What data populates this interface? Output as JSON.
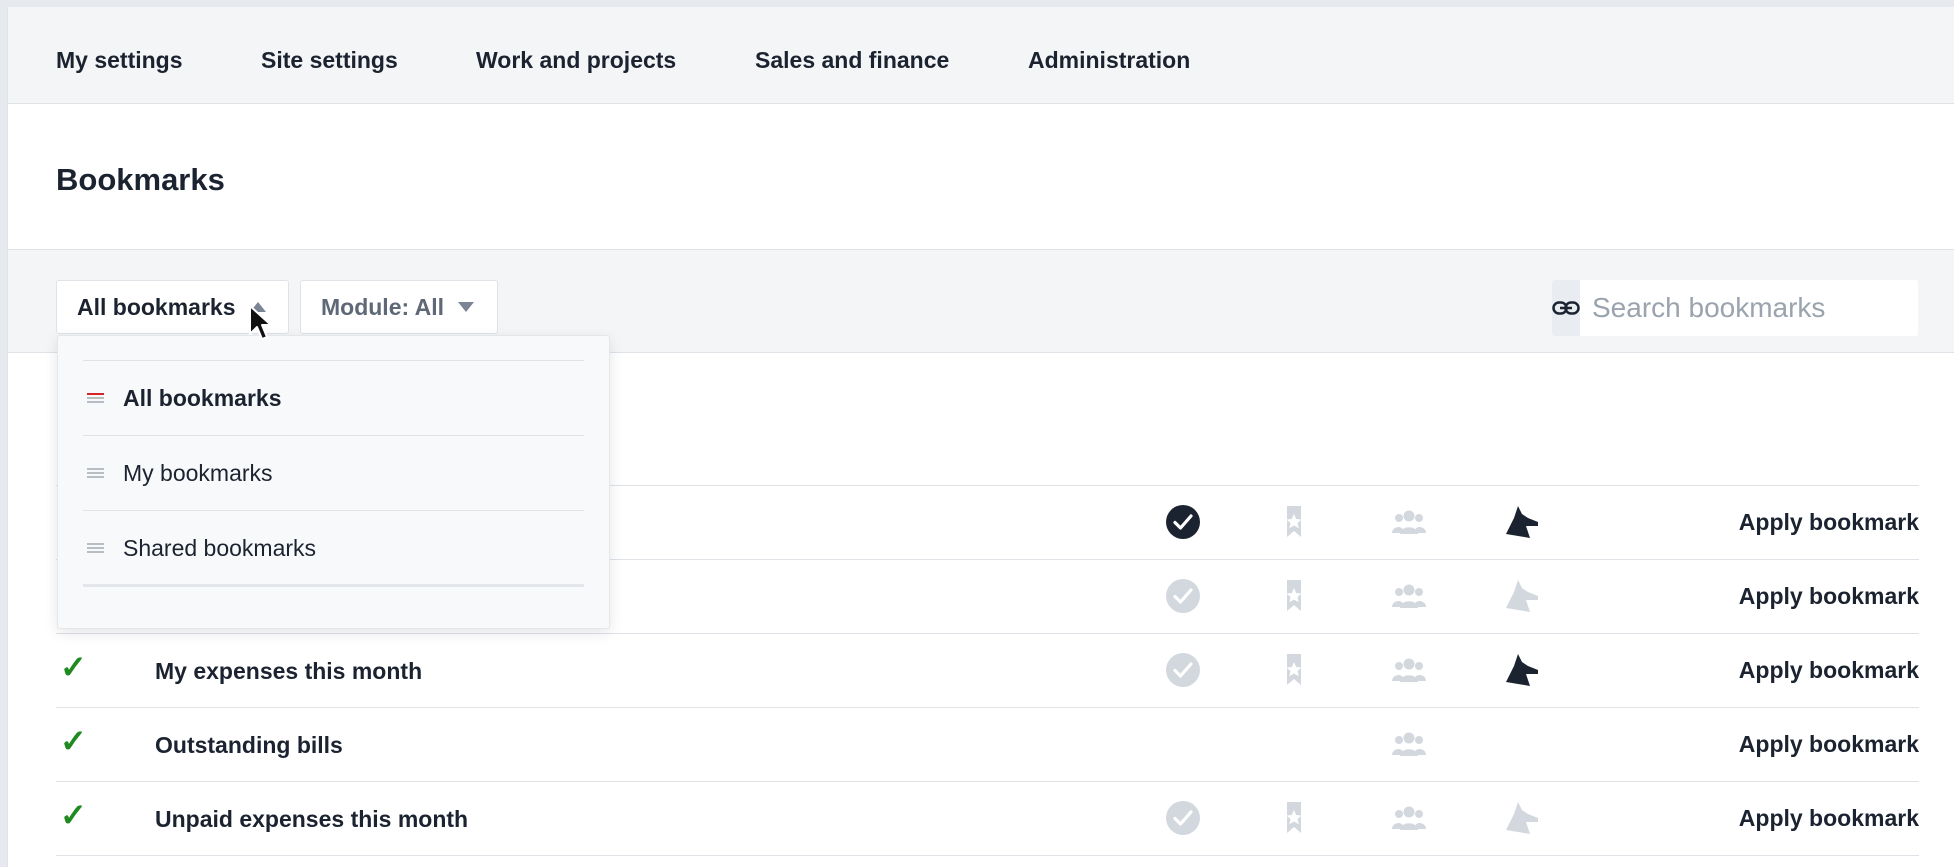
{
  "nav": {
    "items": [
      "My settings",
      "Site settings",
      "Work and projects",
      "Sales and finance",
      "Administration"
    ]
  },
  "page": {
    "title": "Bookmarks"
  },
  "filters": {
    "bookmark_filter_label": "All bookmarks",
    "module_filter_label": "Module: All",
    "search_placeholder": "Search bookmarks"
  },
  "dropdown": {
    "options": [
      {
        "label": "All bookmarks",
        "selected": true
      },
      {
        "label": "My bookmarks",
        "selected": false
      },
      {
        "label": "Shared bookmarks",
        "selected": false
      }
    ]
  },
  "rows": [
    {
      "name": "",
      "checked": false,
      "apply_label": "Apply bookmark",
      "icons": [
        "check-dark",
        "star-light",
        "group-light",
        "dog-dark"
      ]
    },
    {
      "name": "",
      "checked": false,
      "apply_label": "Apply bookmark",
      "icons": [
        "check-light",
        "star-light",
        "group-light",
        "dog-light"
      ]
    },
    {
      "name": "My expenses this month",
      "checked": true,
      "apply_label": "Apply bookmark",
      "icons": [
        "check-light",
        "star-light",
        "group-light",
        "dog-dark"
      ]
    },
    {
      "name": "Outstanding bills",
      "checked": true,
      "apply_label": "Apply bookmark",
      "icons": [
        "",
        "",
        "group-light",
        ""
      ]
    },
    {
      "name": "Unpaid expenses this month",
      "checked": true,
      "apply_label": "Apply bookmark",
      "icons": [
        "check-light",
        "star-light",
        "group-light",
        "dog-light"
      ]
    }
  ],
  "colors": {
    "accent_dark": "#1c2330",
    "icon_light": "#d3d8de",
    "check_green": "#1f8a1f",
    "selected_marker": "#d8232a"
  }
}
